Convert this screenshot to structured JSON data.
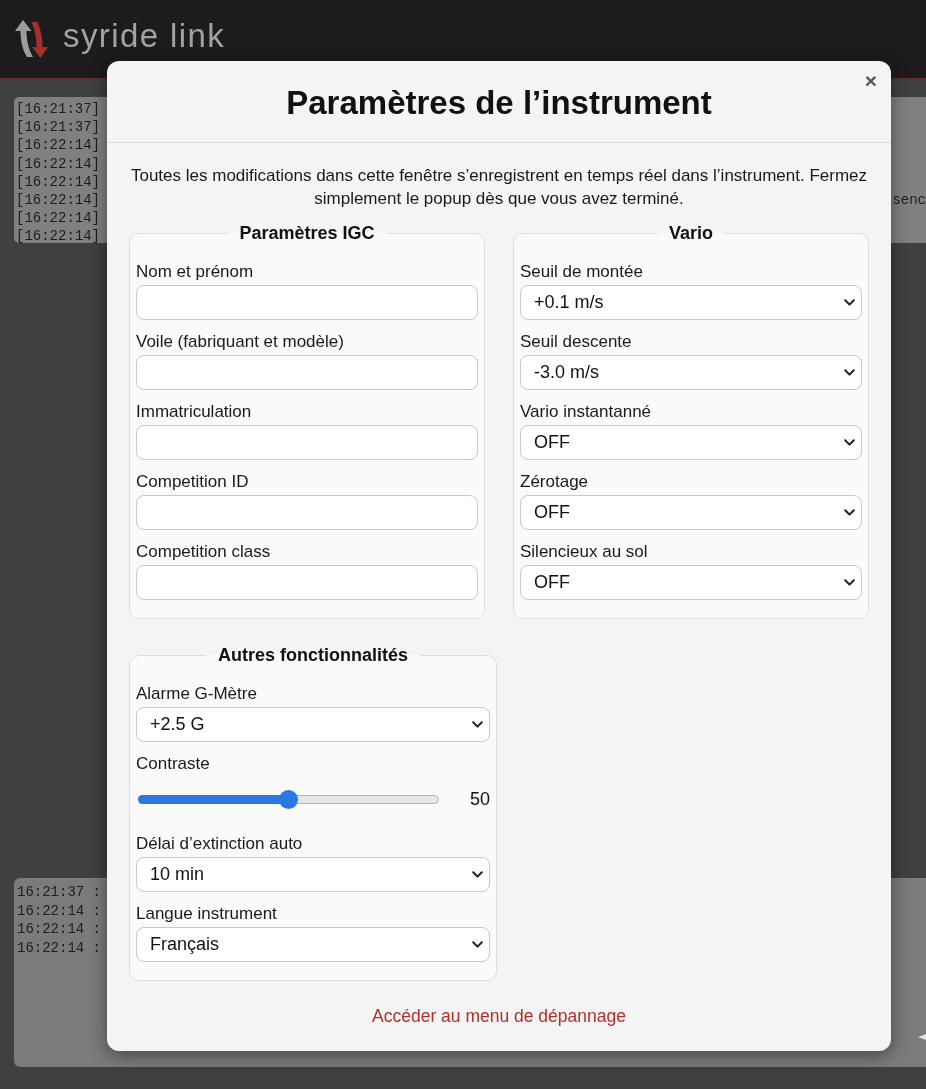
{
  "header": {
    "logo_text": "syride link"
  },
  "console": {
    "lines": [
      {
        "text": "[16:21:37]"
      },
      {
        "text": "[16:21:37]"
      },
      {
        "text": "[16:22:14]"
      },
      {
        "text": "[16:22:14]"
      },
      {
        "text": "[16:22:14]"
      },
      {
        "text": "[16:22:14]",
        "tail": "senc"
      },
      {
        "text": "[16:22:14]"
      },
      {
        "text": "[16:22:14]"
      }
    ]
  },
  "log": {
    "lines": [
      "16:21:37 :",
      "16:22:14 :",
      "16:22:14 :",
      "16:22:14 :"
    ]
  },
  "dialog": {
    "title": "Paramètres de l’instrument",
    "close": "×",
    "intro": "Toutes les modifications dans cette fenêtre s’enregistrent en temps réel dans l’instrument. Fermez simplement le popup dès que vous avez terminé.",
    "sections": [
      {
        "legend": "Paramètres IGC",
        "fields": [
          {
            "kind": "text",
            "label": "Nom et prénom"
          },
          {
            "kind": "text",
            "label": "Voile (fabriquant et modèle)"
          },
          {
            "kind": "text",
            "label": "Immatriculation"
          },
          {
            "kind": "text",
            "label": "Competition ID"
          },
          {
            "kind": "text",
            "label": "Competition class"
          }
        ]
      },
      {
        "legend": "Vario",
        "fields": [
          {
            "kind": "select",
            "label": "Seuil de montée",
            "value": "+0.1 m/s"
          },
          {
            "kind": "select",
            "label": "Seuil descente",
            "value": "-3.0 m/s"
          },
          {
            "kind": "select",
            "label": "Vario instantanné",
            "value": "OFF"
          },
          {
            "kind": "select",
            "label": "Zérotage",
            "value": "OFF"
          },
          {
            "kind": "select",
            "label": "Silencieux au sol",
            "value": "OFF"
          }
        ]
      },
      {
        "legend": "Autres fonctionnalités",
        "fields": [
          {
            "kind": "select",
            "label": "Alarme G-Mètre",
            "value": "+2.5 G"
          },
          {
            "kind": "slider",
            "label": "Contraste",
            "level": 0.5,
            "reading": "50"
          },
          {
            "kind": "select",
            "label": "Délai d’extinction auto",
            "value": "10 min"
          },
          {
            "kind": "select",
            "label": "Langue instrument",
            "value": "Français"
          }
        ]
      }
    ],
    "link": "Accéder au menu de dépannage"
  }
}
